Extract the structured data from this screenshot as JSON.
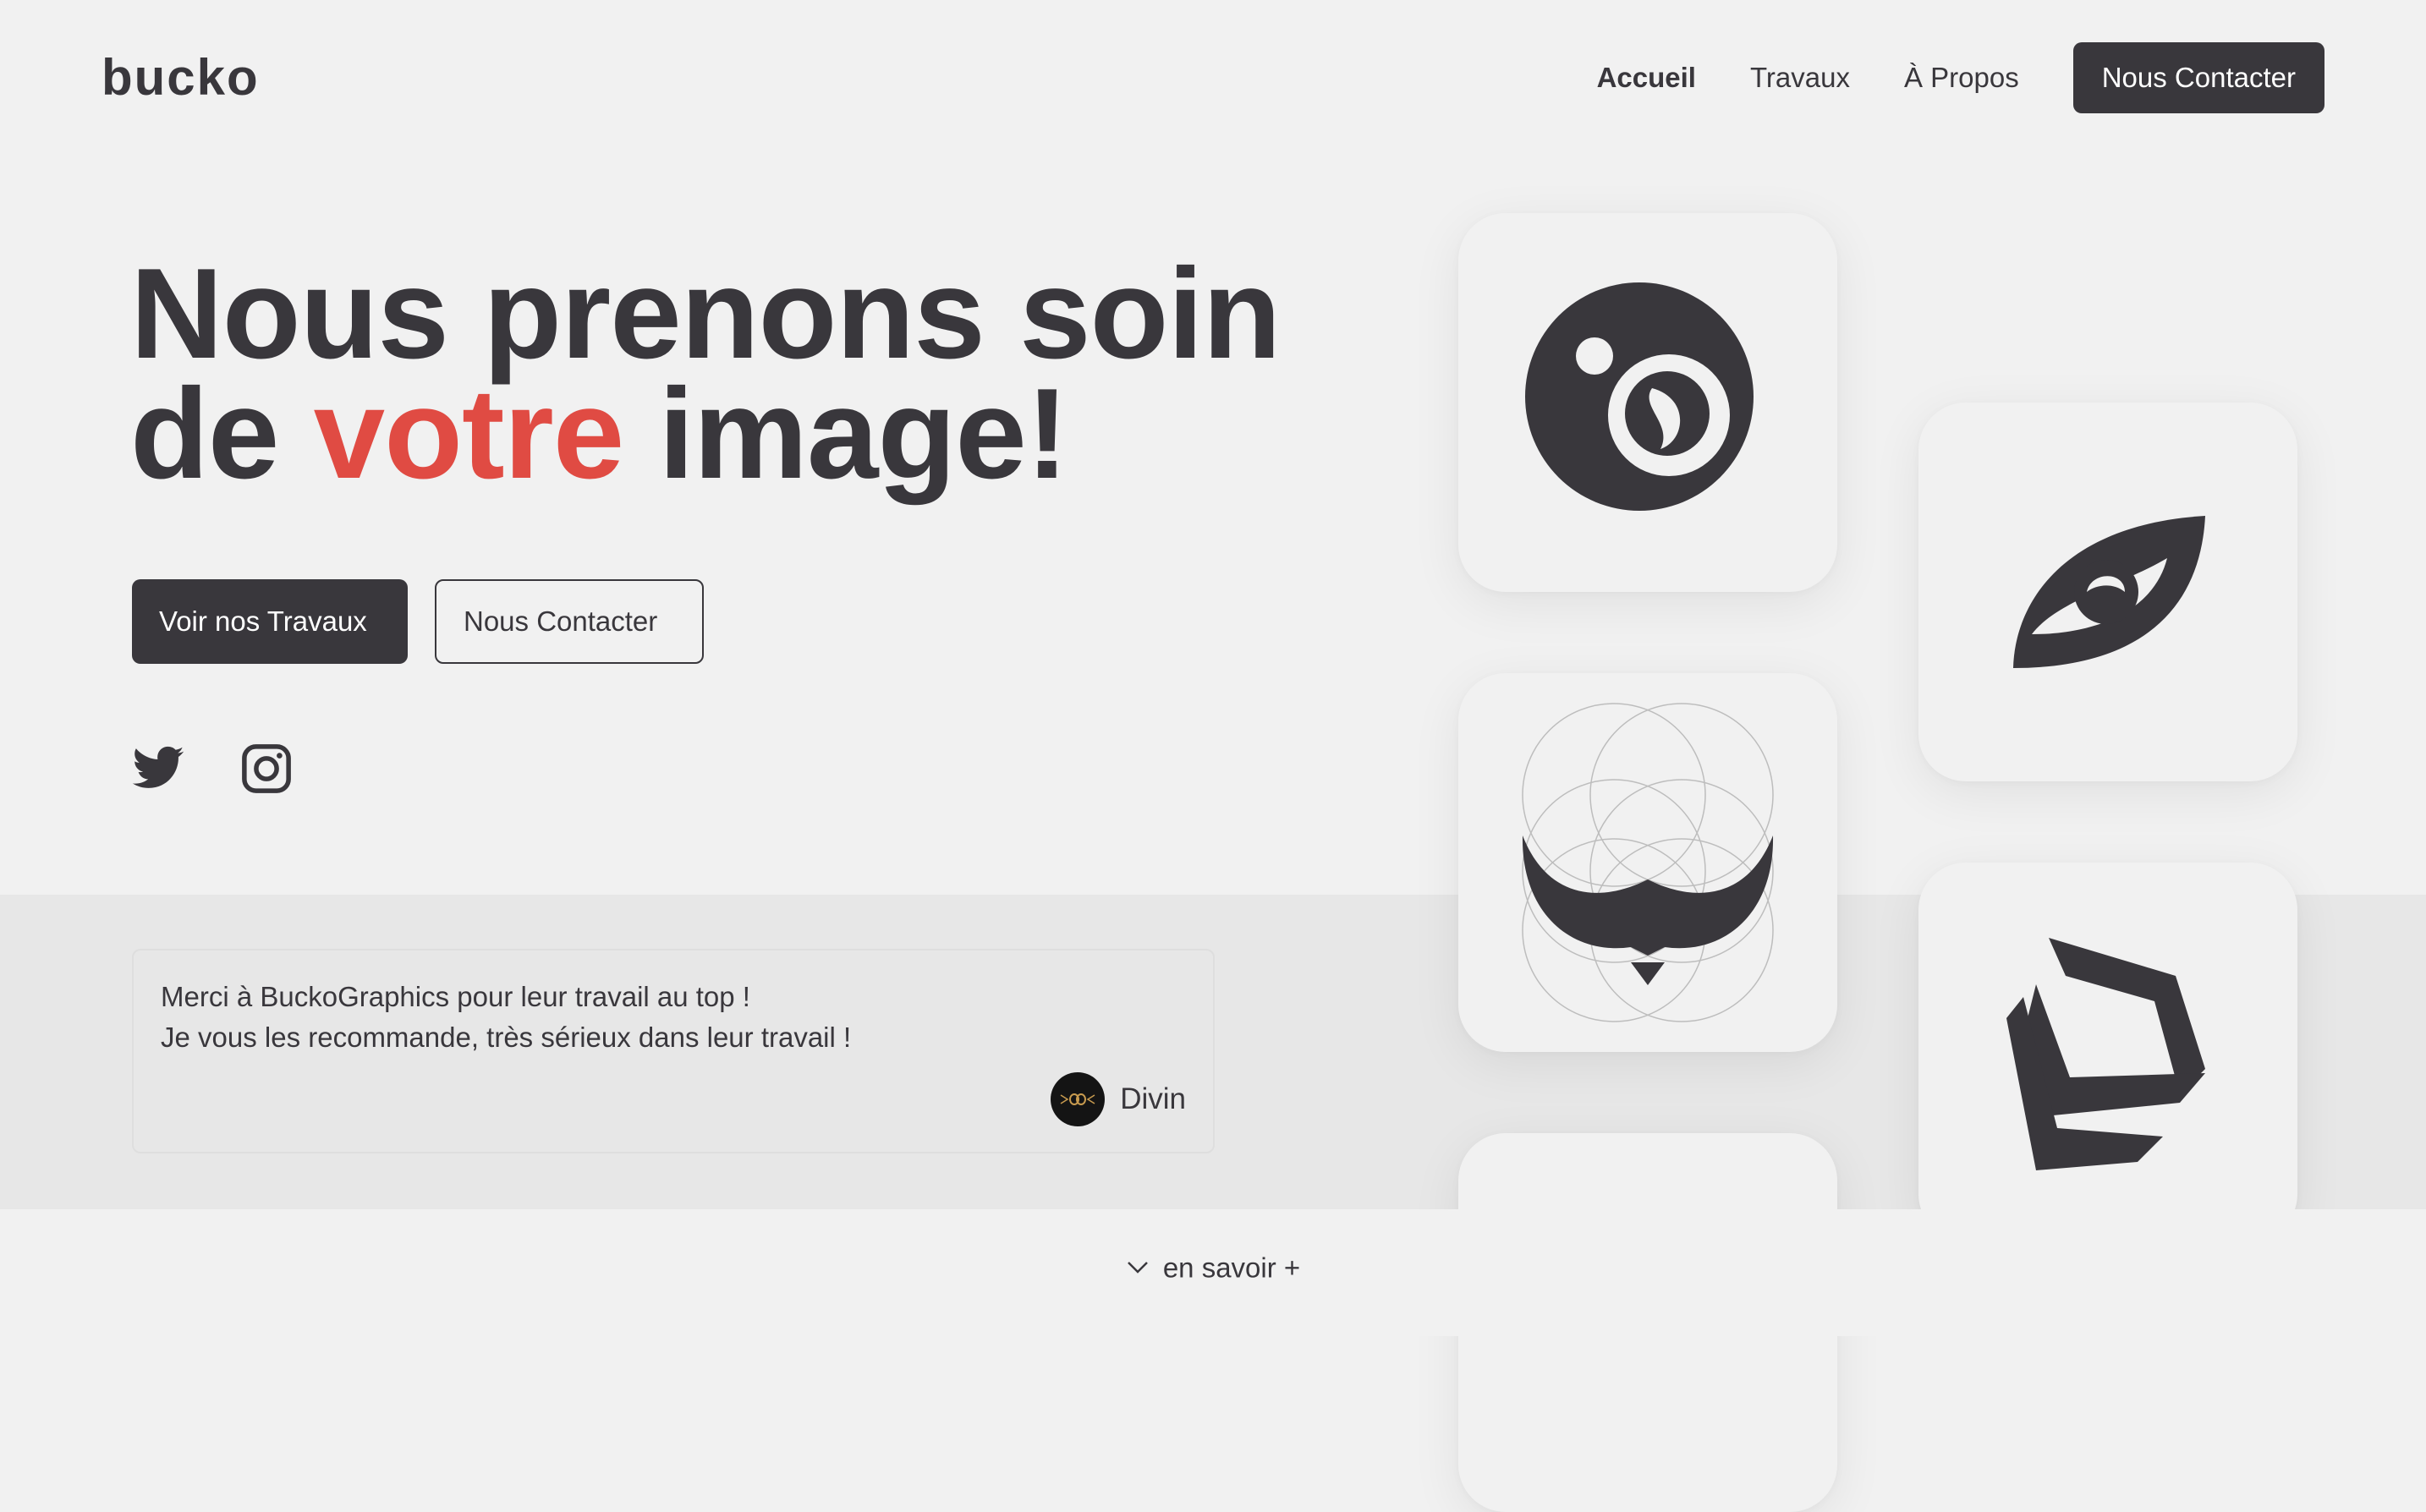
{
  "header": {
    "logo_text": "bucko",
    "nav": {
      "items": [
        {
          "label": "Accueil",
          "active": true
        },
        {
          "label": "Travaux",
          "active": false
        },
        {
          "label": "À Propos",
          "active": false
        }
      ],
      "cta_label": "Nous Contacter"
    }
  },
  "hero": {
    "title_line1": "Nous prenons soin",
    "title_line2_before": "de ",
    "title_line2_accent": "votre",
    "title_line2_after": " image!",
    "primary_button": "Voir nos Travaux",
    "secondary_button": "Nous Contacter",
    "social_icons": [
      "twitter-icon",
      "instagram-icon"
    ]
  },
  "testimonial": {
    "line1": "Merci à BuckoGraphics pour leur travail au top !",
    "line2": "Je vous les recommande, très sérieux dans leur travail !",
    "author": "Divin"
  },
  "cards": [
    "bucko-mark-logo",
    "eye-swirl-logo",
    "mustache-construction-logo",
    "hexagon-blocks-logo",
    "partial-card"
  ],
  "footer": {
    "learn_more": "en savoir +"
  },
  "colors": {
    "dark": "#39373c",
    "accent": "#e04b43",
    "background": "#f1f1f1",
    "band": "#e7e7e7"
  }
}
